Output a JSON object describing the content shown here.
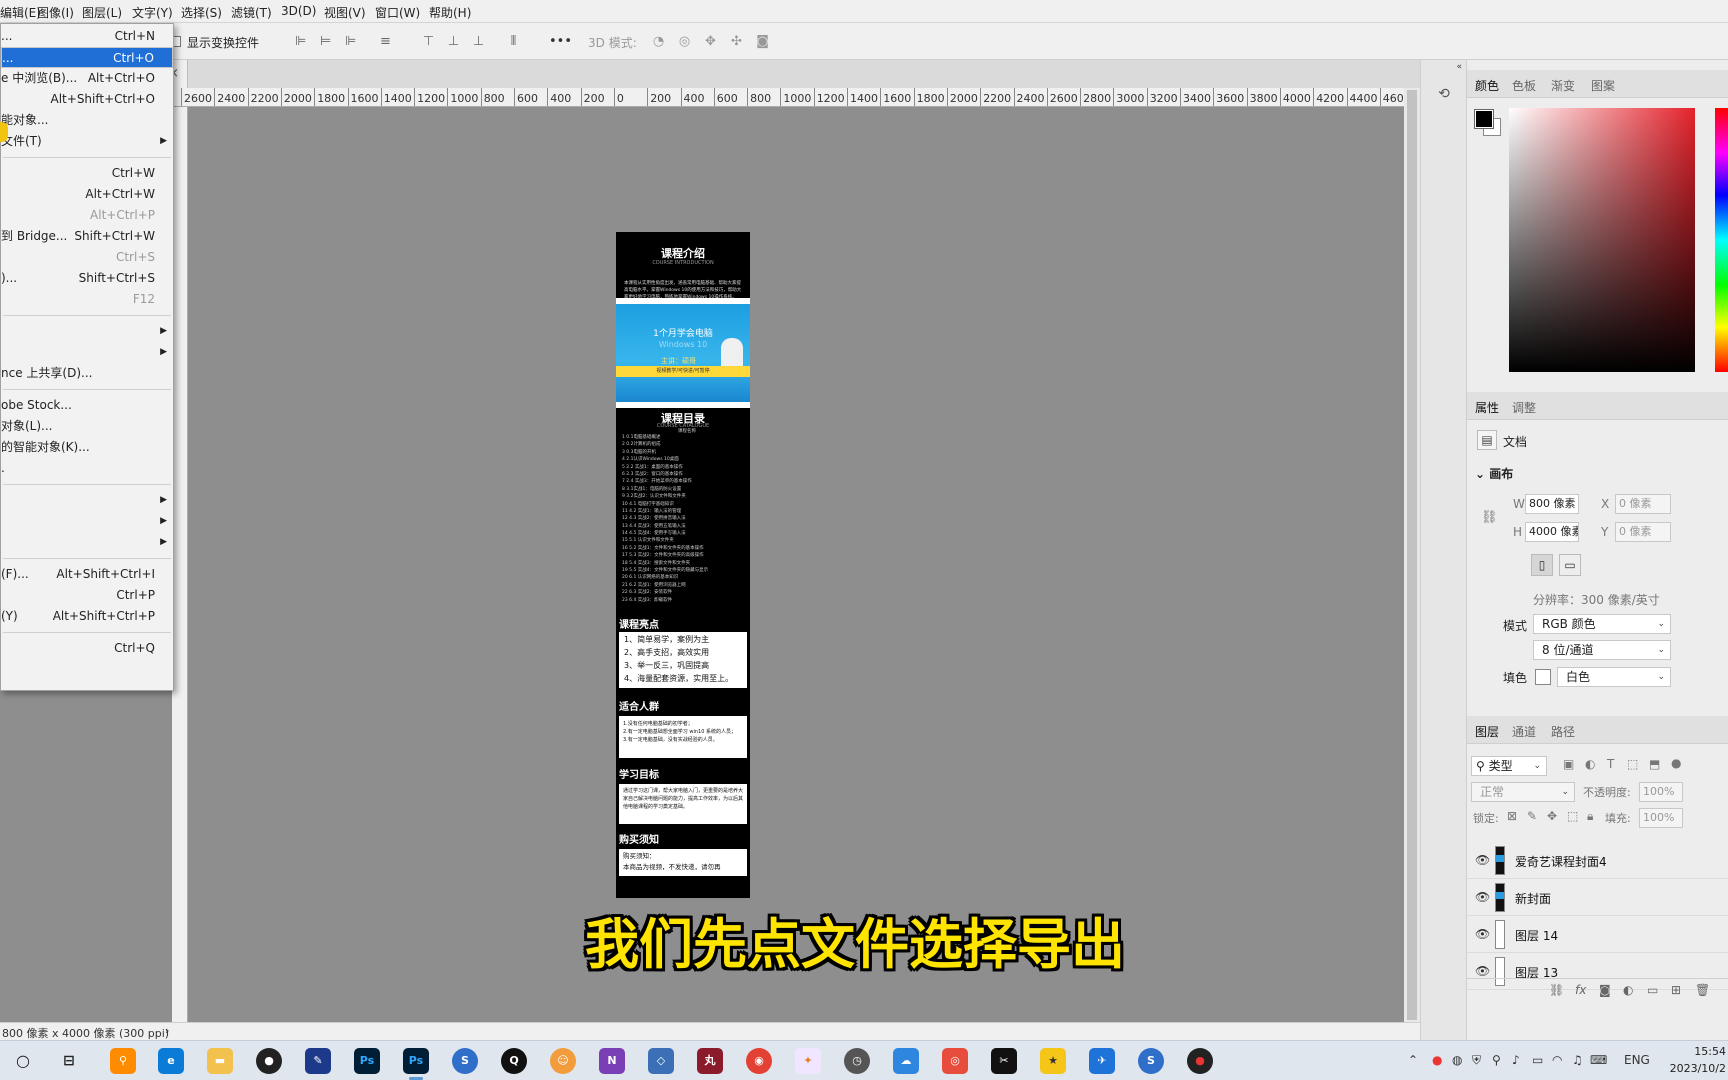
{
  "menubar": [
    "编辑(E)",
    "图像(I)",
    "图层(L)",
    "文字(Y)",
    "选择(S)",
    "滤镜(T)",
    "3D(D)",
    "视图(V)",
    "窗口(W)",
    "帮助(H)"
  ],
  "options": {
    "show_transform": "显示变换控件",
    "more": "•••",
    "mode3d": "3D 模式:"
  },
  "ruler_ticks": [
    "2600",
    "2400",
    "2200",
    "2000",
    "1800",
    "1600",
    "1400",
    "1200",
    "1000",
    "800",
    "600",
    "400",
    "200",
    "0",
    "200",
    "400",
    "600",
    "800",
    "1000",
    "1200",
    "1400",
    "1600",
    "1800",
    "2000",
    "2200",
    "2400",
    "2600",
    "2800",
    "3000",
    "3200",
    "3400",
    "3600",
    "3800",
    "4000",
    "4200",
    "4400",
    "460"
  ],
  "file_menu": [
    {
      "label": "...",
      "shortcut": "Ctrl+N"
    },
    {
      "label": "...",
      "shortcut": "Ctrl+O",
      "selected": true
    },
    {
      "label": "e 中浏览(B)...",
      "shortcut": "Alt+Ctrl+O"
    },
    {
      "label": "",
      "shortcut": "Alt+Shift+Ctrl+O"
    },
    {
      "label": "能对象...",
      "shortcut": ""
    },
    {
      "label": "文件(T)",
      "shortcut": "",
      "submenu": true
    },
    {
      "label": "",
      "shortcut": "Ctrl+W"
    },
    {
      "label": "",
      "shortcut": "Alt+Ctrl+W"
    },
    {
      "label": "",
      "shortcut": "Alt+Ctrl+P",
      "disabled": true
    },
    {
      "label": "到 Bridge...",
      "shortcut": "Shift+Ctrl+W"
    },
    {
      "label": "",
      "shortcut": "Ctrl+S",
      "disabled": true
    },
    {
      "label": ")...",
      "shortcut": "Shift+Ctrl+S"
    },
    {
      "label": "",
      "shortcut": "F12",
      "disabled": true
    },
    {
      "label": "",
      "shortcut": "",
      "submenu": true
    },
    {
      "label": "",
      "shortcut": "",
      "submenu": true
    },
    {
      "label": "nce 上共享(D)...",
      "shortcut": ""
    },
    {
      "label": "obe Stock...",
      "shortcut": ""
    },
    {
      "label": "对象(L)...",
      "shortcut": ""
    },
    {
      "label": "的智能对象(K)...",
      "shortcut": ""
    },
    {
      "label": ".",
      "shortcut": ""
    },
    {
      "label": "",
      "shortcut": "",
      "submenu": true
    },
    {
      "label": "",
      "shortcut": "",
      "submenu": true
    },
    {
      "label": "",
      "shortcut": "",
      "submenu": true
    },
    {
      "label": "(F)...",
      "shortcut": "Alt+Shift+Ctrl+I"
    },
    {
      "label": "",
      "shortcut": "Ctrl+P"
    },
    {
      "label": "(Y)",
      "shortcut": "Alt+Shift+Ctrl+P"
    },
    {
      "label": "",
      "shortcut": "Ctrl+Q"
    }
  ],
  "document": {
    "title": "课程介绍",
    "title_sub": "COURSE INTRODUCTION",
    "intro": "本课程从实用性角度出发，涵盖常用电脑基础、帮助大家提高电脑水平。掌握Windows 10的使用方法和技巧，帮助大家更好地学习电脑，熟练地掌握Windows 10操作系统。",
    "banner_title": "1个月学会电脑",
    "banner_sub": "Windows 10",
    "banner_lecturer": "主讲：硕哥",
    "banner_bar": "视频教学/可快进/可暂停",
    "catalog_title": "课程目录",
    "catalog_sub": "COURSE CATALOGUE",
    "catalog_header": "课程名称",
    "catalog": [
      "1  0.1电脑基础概述",
      "2  0.2计算机的组成",
      "3  0.3电脑的开机",
      "4  2.1认识Windows 10桌面",
      "5  2.2 实战1：桌面的基本操作",
      "6  2.3 实战2：窗口的基本操作",
      "7  2.4 实战3：开始菜单的基本操作",
      "8  3.1实战1：电脑的防火设置",
      "9  3.2实战2：认识文件和文件夹",
      "10  4.1 电脑打字基础知识",
      "11  4.2 实战1：输入法的管理",
      "12  4.3 实战2：使用拼音输入法",
      "13  4.4 实战3：使用五笔输入法",
      "14  4.5 实战4：使用手写输入法",
      "15  5.1 认识文件和文件夹",
      "16  5.2 实战1：文件和文件夹的基本操作",
      "17  5.3 实战2：文件和文件夹的高级操作",
      "18  5.4 实战3：搜索文件和文件夹",
      "19  5.5 实战4：文件和文件夹的隐藏与显示",
      "20  6.1 认识网络的基本知识",
      "21  6.2 实战1：使用浏览器上网",
      "22  6.3 实战2：安装软件",
      "23  6.4 实战3：卸载软件"
    ],
    "highlights_title": "课程亮点",
    "highlights": [
      "1、简单易学，案例为主",
      "2、高手支招，高效实用",
      "3、举一反三，巩固提高",
      "4、海量配套资源，实用至上。"
    ],
    "audience_title": "适合人群",
    "audience": [
      "1.没有任何电脑基础的初学者；",
      "2.有一定电脑基础想全面学习 win10 系统的人员；",
      "3.有一定电脑基础，没有实战经验的人员。"
    ],
    "goal_title": "学习目标",
    "goal": "通过学习这门课，帮大家电脑入门，更重要的是培养大家自己解决电脑问题的能力，提高工作效率，为以后其他电脑课程的学习奠定基础。",
    "notice_title": "购买须知",
    "notice": [
      "购买须知：",
      "本商品为视频，不发快递，请勿再"
    ]
  },
  "status": "800 像素 x 4000 像素 (300 ppi)",
  "color_panel": {
    "tabs": [
      "颜色",
      "色板",
      "渐变",
      "图案"
    ]
  },
  "props_panel": {
    "tabs": [
      "属性",
      "调整"
    ],
    "doc_label": "文档",
    "section": "画布",
    "w_label": "W",
    "w_value": "800 像素",
    "h_label": "H",
    "h_value": "4000 像素",
    "x_label": "X",
    "x_value": "0 像素",
    "y_label": "Y",
    "y_value": "0 像素",
    "resolution": "分辨率：300 像素/英寸",
    "mode_label": "模式",
    "mode_value": "RGB 颜色",
    "depth_value": "8 位/通道",
    "fill_label": "填色",
    "fill_value": "白色"
  },
  "layers_panel": {
    "tabs": [
      "图层",
      "通道",
      "路径"
    ],
    "filter": "类型",
    "blend": "正常",
    "opacity_label": "不透明度:",
    "opacity": "100%",
    "lock_label": "锁定:",
    "fill_label": "填充:",
    "fill": "100%",
    "layers": [
      "爱奇艺课程封面4",
      "新封面",
      "图层 14",
      "图层 13"
    ]
  },
  "subtitle": "我们先点文件选择导出",
  "taskbar": {
    "lang": "ENG",
    "time": "15:54",
    "date": "2023/10/2"
  },
  "colors": {
    "menu_highlight": "#1f6fd6",
    "subtitle": "#ffe400",
    "banner_blue": "#2a9be0"
  }
}
